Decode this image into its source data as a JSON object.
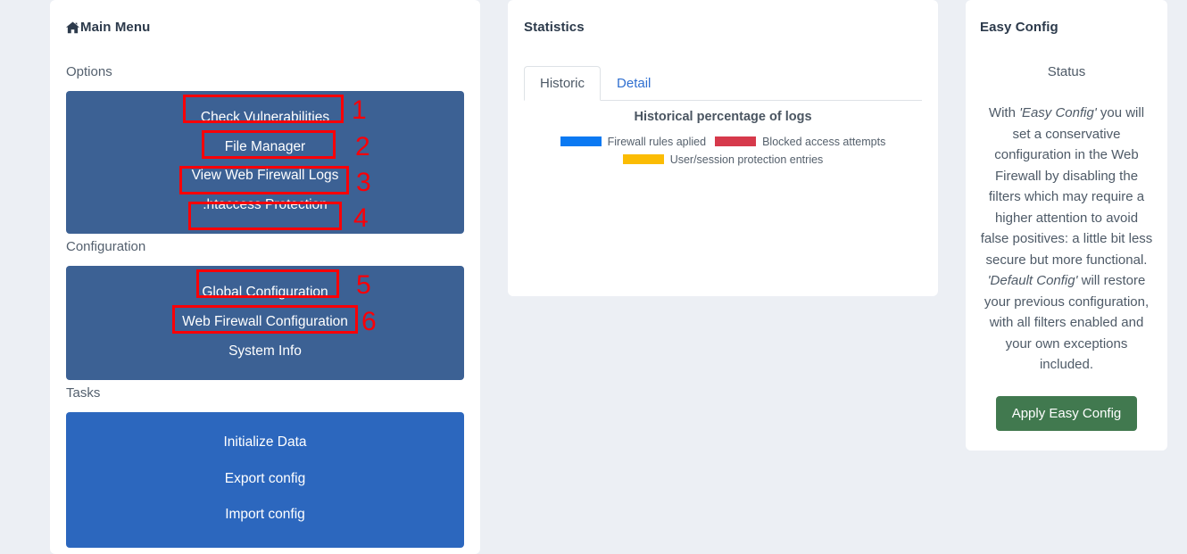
{
  "page": {
    "background_color": "#eceff4"
  },
  "main_menu": {
    "title": "Main Menu",
    "home_icon": "home-icon",
    "sections": [
      {
        "label": "Options",
        "style": "slate",
        "panel_color": "#3c6194",
        "items": [
          {
            "label": "Check Vulnerabilities",
            "annotation": "1"
          },
          {
            "label": "File Manager",
            "annotation": "2"
          },
          {
            "label": "View Web Firewall Logs",
            "annotation": "3"
          },
          {
            "label": ".htaccess Protection",
            "annotation": "4"
          }
        ]
      },
      {
        "label": "Configuration",
        "style": "slate",
        "panel_color": "#3c6194",
        "items": [
          {
            "label": "Global Configuration",
            "annotation": "5"
          },
          {
            "label": "Web Firewall Configuration",
            "annotation": "6"
          },
          {
            "label": "System Info",
            "annotation": ""
          }
        ]
      },
      {
        "label": "Tasks",
        "style": "blue",
        "panel_color": "#2c67be",
        "items": [
          {
            "label": "Initialize Data",
            "annotation": ""
          },
          {
            "label": "Export config",
            "annotation": ""
          },
          {
            "label": "Import config",
            "annotation": ""
          }
        ]
      }
    ]
  },
  "statistics": {
    "title": "Statistics",
    "tabs": [
      {
        "label": "Historic",
        "active": true
      },
      {
        "label": "Detail",
        "active": false
      }
    ]
  },
  "chart_data": {
    "type": "line",
    "title": "Historical percentage of logs",
    "xlabel": "",
    "ylabel": "",
    "grid": false,
    "legend_position": "top",
    "series": [
      {
        "name": "Firewall rules aplied",
        "color": "#0b79f2",
        "values": []
      },
      {
        "name": "Blocked access attempts",
        "color": "#d63council",
        "values": []
      },
      {
        "name": "User/session protection entries",
        "color": "#fbbc04",
        "values": []
      }
    ],
    "legend": [
      {
        "label": "Firewall rules aplied",
        "color": "#0b79f2"
      },
      {
        "label": "Blocked access attempts",
        "color": "#d6394b"
      },
      {
        "label": "User/session protection entries",
        "color": "#fbbc04"
      }
    ],
    "categories": [],
    "note": "No data series plotted; chart canvas is empty."
  },
  "easy_config": {
    "title": "Easy Config",
    "status_label": "Status",
    "body_part1": "With ",
    "body_em1": "'Easy Config'",
    "body_part2": " you will set a conservative configuration in the Web Firewall by disabling the filters which may require a higher attention to avoid false positives: a little bit less secure but more functional.",
    "body_em2": "'Default Config'",
    "body_part3": " will restore your previous configuration, with all filters enabled and your own exceptions included.",
    "apply_label": "Apply Easy Config",
    "apply_color": "#41794f"
  },
  "annotations": {
    "box_color": "#fb0007",
    "numbers": [
      "1",
      "2",
      "3",
      "4",
      "5",
      "6"
    ]
  }
}
